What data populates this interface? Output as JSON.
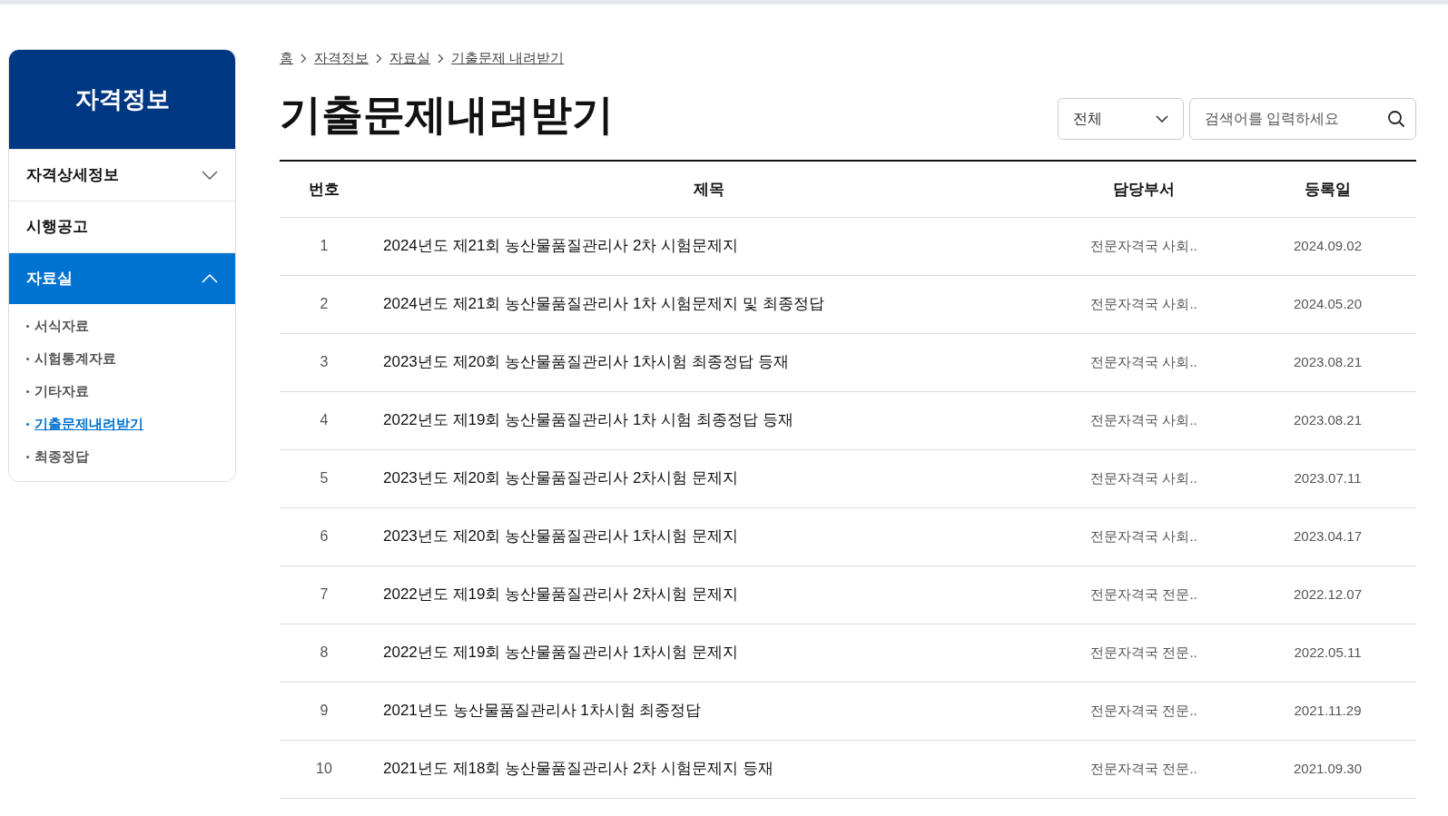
{
  "sidebar": {
    "title": "자격정보",
    "items": [
      {
        "label": "자격상세정보",
        "kind": "collapsible",
        "expanded": false,
        "selected": false
      },
      {
        "label": "시행공고",
        "kind": "link",
        "selected": false
      },
      {
        "label": "자료실",
        "kind": "collapsible",
        "expanded": true,
        "selected": true,
        "children": [
          {
            "label": "서식자료",
            "selected": false
          },
          {
            "label": "시험통계자료",
            "selected": false
          },
          {
            "label": "기타자료",
            "selected": false
          },
          {
            "label": "기출문제내려받기",
            "selected": true
          },
          {
            "label": "최종정답",
            "selected": false
          }
        ]
      }
    ]
  },
  "breadcrumb": [
    "홈",
    "자격정보",
    "자료실",
    "기출문제 내려받기"
  ],
  "page_title": "기출문제내려받기",
  "filter": {
    "value": "전체"
  },
  "search": {
    "placeholder": "검색어를 입력하세요"
  },
  "table": {
    "columns": [
      "번호",
      "제목",
      "담당부서",
      "등록일"
    ],
    "rows": [
      [
        "1",
        "2024년도 제21회 농산물품질관리사 2차 시험문제지",
        "전문자격국 사회..",
        "2024.09.02"
      ],
      [
        "2",
        "2024년도 제21회 농산물품질관리사 1차 시험문제지 및 최종정답",
        "전문자격국 사회..",
        "2024.05.20"
      ],
      [
        "3",
        "2023년도 제20회 농산물품질관리사 1차시험 최종정답 등재",
        "전문자격국 사회..",
        "2023.08.21"
      ],
      [
        "4",
        "2022년도 제19회 농산물품질관리사 1차 시험 최종정답 등재",
        "전문자격국 사회..",
        "2023.08.21"
      ],
      [
        "5",
        "2023년도 제20회 농산물품질관리사 2차시험 문제지",
        "전문자격국 사회..",
        "2023.07.11"
      ],
      [
        "6",
        "2023년도 제20회 농산물품질관리사 1차시험 문제지",
        "전문자격국 사회..",
        "2023.04.17"
      ],
      [
        "7",
        "2022년도 제19회 농산물품질관리사 2차시험 문제지",
        "전문자격국 전문..",
        "2022.12.07"
      ],
      [
        "8",
        "2022년도 제19회 농산물품질관리사 1차시험 문제지",
        "전문자격국 전문..",
        "2022.05.11"
      ],
      [
        "9",
        "2021년도 농산물품질관리사 1차시험 최종정답",
        "전문자격국 전문..",
        "2021.11.29"
      ],
      [
        "10",
        "2021년도 제18회 농산물품질관리사 2차 시험문제지 등재",
        "전문자격국 전문..",
        "2021.09.30"
      ]
    ]
  }
}
